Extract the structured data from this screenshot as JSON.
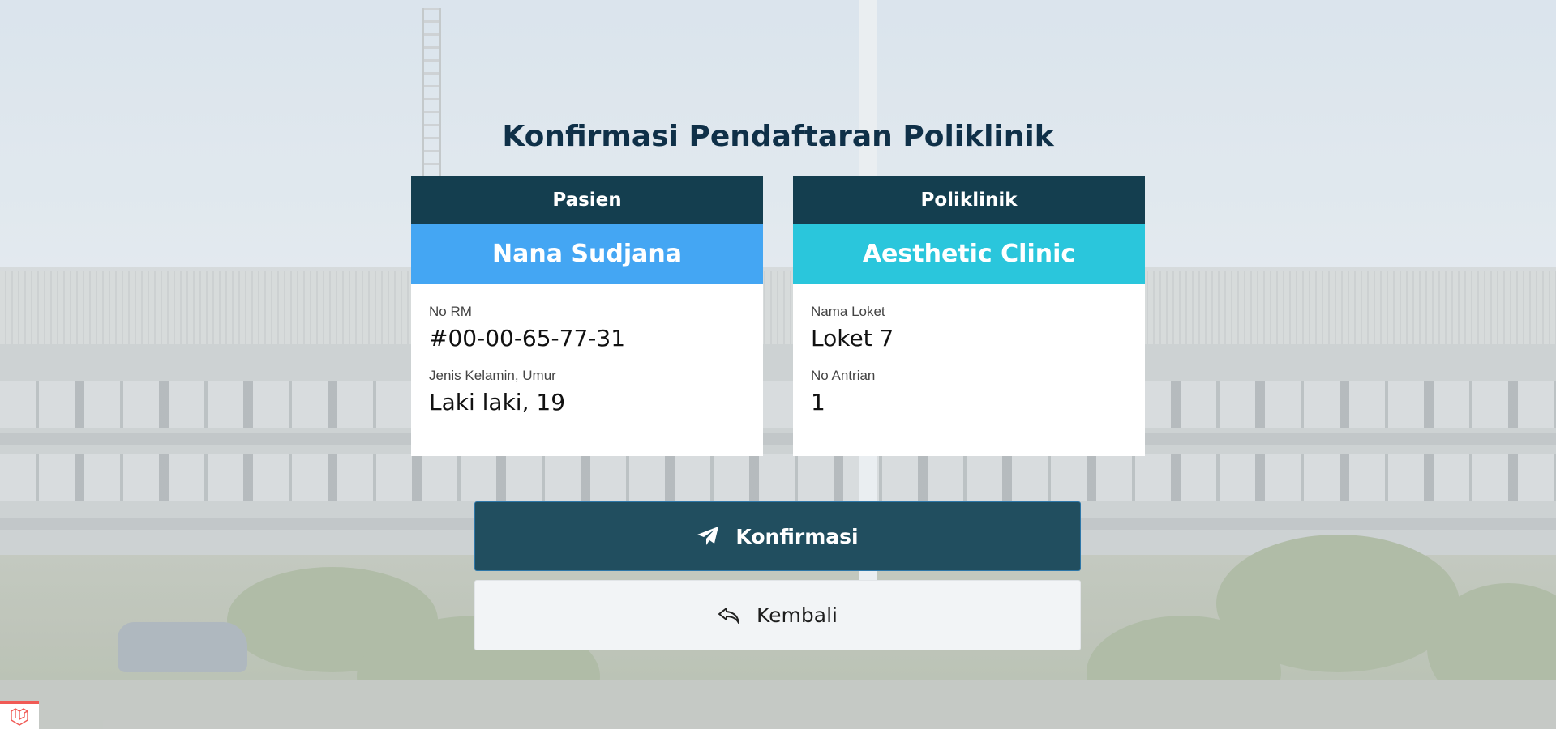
{
  "page": {
    "title": "Konfirmasi Pendaftaran Poliklinik"
  },
  "patient_card": {
    "header": "Pasien",
    "name": "Nana Sudjana",
    "fields": [
      {
        "label": "No RM",
        "value": "#00-00-65-77-31"
      },
      {
        "label": "Jenis Kelamin, Umur",
        "value": "Laki laki, 19"
      }
    ]
  },
  "clinic_card": {
    "header": "Poliklinik",
    "name": "Aesthetic Clinic",
    "fields": [
      {
        "label": "Nama Loket",
        "value": "Loket 7"
      },
      {
        "label": "No Antrian",
        "value": "1"
      }
    ]
  },
  "actions": {
    "confirm_label": "Konfirmasi",
    "confirm_icon": "paper-plane-icon",
    "back_label": "Kembali",
    "back_icon": "reply-arrow-icon"
  },
  "colors": {
    "title": "#0f3048",
    "card_header": "#143e4f",
    "patient_accent": "#44a6f3",
    "clinic_accent": "#2ac6dc",
    "primary_button": "#214e5f"
  }
}
